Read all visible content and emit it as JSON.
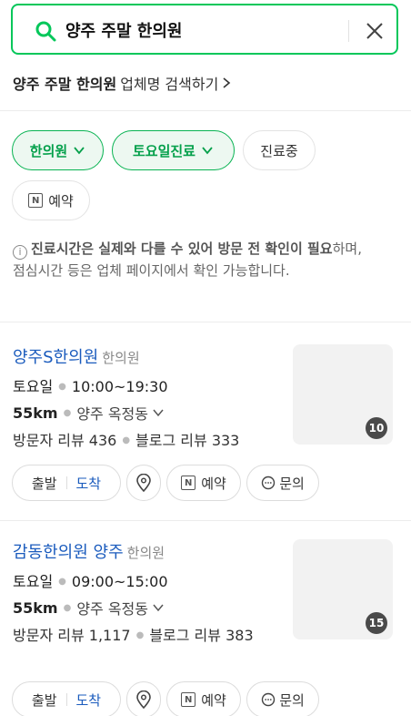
{
  "search": {
    "query": "양주 주말 한의원",
    "search_icon": "search-icon",
    "clear_icon": "close-icon"
  },
  "suggestion": {
    "query": "양주 주말 한의원",
    "text": "업체명 검색하기",
    "icon": "chevron-right-icon"
  },
  "filters": {
    "chips": [
      {
        "label": "한의원",
        "active": true,
        "dropdown": true
      },
      {
        "label": "토요일진료",
        "active": true,
        "dropdown": true
      },
      {
        "label": "진료중",
        "active": false,
        "dropdown": false
      }
    ],
    "booking_chip": {
      "label": "예약",
      "icon": "naver-booking-icon",
      "icon_letter": "N"
    }
  },
  "notice": {
    "icon_glyph": "i",
    "bold": "진료시간은 실제와 다를 수 있어 방문 전 확인이 필요",
    "normal": "하며, 점심시간 등은 업체 페이지에서 확인 가능합니다."
  },
  "places": [
    {
      "name": "양주S한의원",
      "category": "한의원",
      "day": "토요일",
      "hours": "10:00~19:30",
      "distance": "55km",
      "location": "양주 옥정동",
      "visitor_reviews": "방문자 리뷰 436",
      "blog_reviews": "블로그 리뷰 333",
      "photo_count": "10",
      "actions": {
        "depart": "출발",
        "arrive": "도착",
        "book": "예약",
        "inquiry": "문의"
      }
    },
    {
      "name": "감동한의원 양주",
      "category": "한의원",
      "day": "토요일",
      "hours": "09:00~15:00",
      "distance": "55km",
      "location": "양주 옥정동",
      "visitor_reviews": "방문자 리뷰 1,117",
      "blog_reviews": "블로그 리뷰 383",
      "photo_count": "15",
      "actions": {
        "depart": "출발",
        "arrive": "도착",
        "book": "예약",
        "inquiry": "문의"
      }
    }
  ],
  "colors": {
    "brand_green": "#03c75a",
    "link_blue": "#1a5bbd"
  }
}
